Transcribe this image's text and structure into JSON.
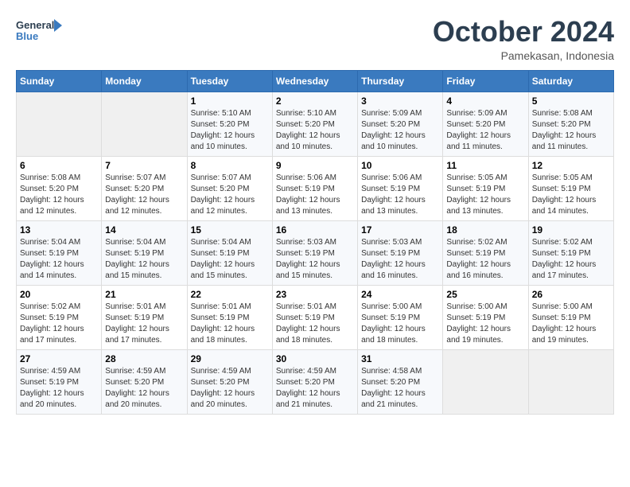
{
  "header": {
    "logo_line1": "General",
    "logo_line2": "Blue",
    "month_title": "October 2024",
    "location": "Pamekasan, Indonesia"
  },
  "weekdays": [
    "Sunday",
    "Monday",
    "Tuesday",
    "Wednesday",
    "Thursday",
    "Friday",
    "Saturday"
  ],
  "weeks": [
    [
      {
        "day": "",
        "sunrise": "",
        "sunset": "",
        "daylight": ""
      },
      {
        "day": "",
        "sunrise": "",
        "sunset": "",
        "daylight": ""
      },
      {
        "day": "1",
        "sunrise": "Sunrise: 5:10 AM",
        "sunset": "Sunset: 5:20 PM",
        "daylight": "Daylight: 12 hours and 10 minutes."
      },
      {
        "day": "2",
        "sunrise": "Sunrise: 5:10 AM",
        "sunset": "Sunset: 5:20 PM",
        "daylight": "Daylight: 12 hours and 10 minutes."
      },
      {
        "day": "3",
        "sunrise": "Sunrise: 5:09 AM",
        "sunset": "Sunset: 5:20 PM",
        "daylight": "Daylight: 12 hours and 10 minutes."
      },
      {
        "day": "4",
        "sunrise": "Sunrise: 5:09 AM",
        "sunset": "Sunset: 5:20 PM",
        "daylight": "Daylight: 12 hours and 11 minutes."
      },
      {
        "day": "5",
        "sunrise": "Sunrise: 5:08 AM",
        "sunset": "Sunset: 5:20 PM",
        "daylight": "Daylight: 12 hours and 11 minutes."
      }
    ],
    [
      {
        "day": "6",
        "sunrise": "Sunrise: 5:08 AM",
        "sunset": "Sunset: 5:20 PM",
        "daylight": "Daylight: 12 hours and 12 minutes."
      },
      {
        "day": "7",
        "sunrise": "Sunrise: 5:07 AM",
        "sunset": "Sunset: 5:20 PM",
        "daylight": "Daylight: 12 hours and 12 minutes."
      },
      {
        "day": "8",
        "sunrise": "Sunrise: 5:07 AM",
        "sunset": "Sunset: 5:20 PM",
        "daylight": "Daylight: 12 hours and 12 minutes."
      },
      {
        "day": "9",
        "sunrise": "Sunrise: 5:06 AM",
        "sunset": "Sunset: 5:19 PM",
        "daylight": "Daylight: 12 hours and 13 minutes."
      },
      {
        "day": "10",
        "sunrise": "Sunrise: 5:06 AM",
        "sunset": "Sunset: 5:19 PM",
        "daylight": "Daylight: 12 hours and 13 minutes."
      },
      {
        "day": "11",
        "sunrise": "Sunrise: 5:05 AM",
        "sunset": "Sunset: 5:19 PM",
        "daylight": "Daylight: 12 hours and 13 minutes."
      },
      {
        "day": "12",
        "sunrise": "Sunrise: 5:05 AM",
        "sunset": "Sunset: 5:19 PM",
        "daylight": "Daylight: 12 hours and 14 minutes."
      }
    ],
    [
      {
        "day": "13",
        "sunrise": "Sunrise: 5:04 AM",
        "sunset": "Sunset: 5:19 PM",
        "daylight": "Daylight: 12 hours and 14 minutes."
      },
      {
        "day": "14",
        "sunrise": "Sunrise: 5:04 AM",
        "sunset": "Sunset: 5:19 PM",
        "daylight": "Daylight: 12 hours and 15 minutes."
      },
      {
        "day": "15",
        "sunrise": "Sunrise: 5:04 AM",
        "sunset": "Sunset: 5:19 PM",
        "daylight": "Daylight: 12 hours and 15 minutes."
      },
      {
        "day": "16",
        "sunrise": "Sunrise: 5:03 AM",
        "sunset": "Sunset: 5:19 PM",
        "daylight": "Daylight: 12 hours and 15 minutes."
      },
      {
        "day": "17",
        "sunrise": "Sunrise: 5:03 AM",
        "sunset": "Sunset: 5:19 PM",
        "daylight": "Daylight: 12 hours and 16 minutes."
      },
      {
        "day": "18",
        "sunrise": "Sunrise: 5:02 AM",
        "sunset": "Sunset: 5:19 PM",
        "daylight": "Daylight: 12 hours and 16 minutes."
      },
      {
        "day": "19",
        "sunrise": "Sunrise: 5:02 AM",
        "sunset": "Sunset: 5:19 PM",
        "daylight": "Daylight: 12 hours and 17 minutes."
      }
    ],
    [
      {
        "day": "20",
        "sunrise": "Sunrise: 5:02 AM",
        "sunset": "Sunset: 5:19 PM",
        "daylight": "Daylight: 12 hours and 17 minutes."
      },
      {
        "day": "21",
        "sunrise": "Sunrise: 5:01 AM",
        "sunset": "Sunset: 5:19 PM",
        "daylight": "Daylight: 12 hours and 17 minutes."
      },
      {
        "day": "22",
        "sunrise": "Sunrise: 5:01 AM",
        "sunset": "Sunset: 5:19 PM",
        "daylight": "Daylight: 12 hours and 18 minutes."
      },
      {
        "day": "23",
        "sunrise": "Sunrise: 5:01 AM",
        "sunset": "Sunset: 5:19 PM",
        "daylight": "Daylight: 12 hours and 18 minutes."
      },
      {
        "day": "24",
        "sunrise": "Sunrise: 5:00 AM",
        "sunset": "Sunset: 5:19 PM",
        "daylight": "Daylight: 12 hours and 18 minutes."
      },
      {
        "day": "25",
        "sunrise": "Sunrise: 5:00 AM",
        "sunset": "Sunset: 5:19 PM",
        "daylight": "Daylight: 12 hours and 19 minutes."
      },
      {
        "day": "26",
        "sunrise": "Sunrise: 5:00 AM",
        "sunset": "Sunset: 5:19 PM",
        "daylight": "Daylight: 12 hours and 19 minutes."
      }
    ],
    [
      {
        "day": "27",
        "sunrise": "Sunrise: 4:59 AM",
        "sunset": "Sunset: 5:19 PM",
        "daylight": "Daylight: 12 hours and 20 minutes."
      },
      {
        "day": "28",
        "sunrise": "Sunrise: 4:59 AM",
        "sunset": "Sunset: 5:20 PM",
        "daylight": "Daylight: 12 hours and 20 minutes."
      },
      {
        "day": "29",
        "sunrise": "Sunrise: 4:59 AM",
        "sunset": "Sunset: 5:20 PM",
        "daylight": "Daylight: 12 hours and 20 minutes."
      },
      {
        "day": "30",
        "sunrise": "Sunrise: 4:59 AM",
        "sunset": "Sunset: 5:20 PM",
        "daylight": "Daylight: 12 hours and 21 minutes."
      },
      {
        "day": "31",
        "sunrise": "Sunrise: 4:58 AM",
        "sunset": "Sunset: 5:20 PM",
        "daylight": "Daylight: 12 hours and 21 minutes."
      },
      {
        "day": "",
        "sunrise": "",
        "sunset": "",
        "daylight": ""
      },
      {
        "day": "",
        "sunrise": "",
        "sunset": "",
        "daylight": ""
      }
    ]
  ]
}
